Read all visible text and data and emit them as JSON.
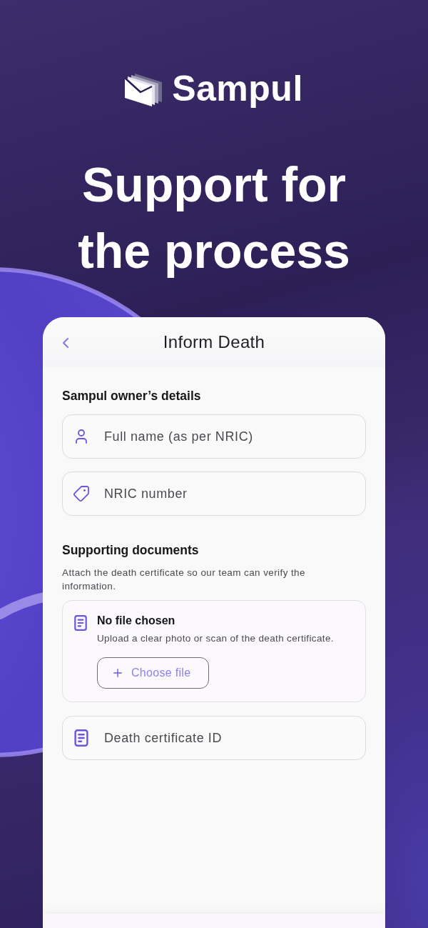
{
  "brand": {
    "name": "Sampul"
  },
  "headline": [
    "Support for",
    "the process"
  ],
  "screen": {
    "title": "Inform Death"
  },
  "owner_section": {
    "title": "Sampul owner’s details",
    "fields": [
      {
        "kind": "person",
        "placeholder": "Full name (as per NRIC)"
      },
      {
        "kind": "tag",
        "placeholder": "NRIC number"
      }
    ]
  },
  "documents_section": {
    "title": "Supporting documents",
    "description": "Attach the death certificate so our team can verify the information.",
    "upload": {
      "title": "No file chosen",
      "hint": "Upload a clear photo or scan of the death certificate.",
      "button": "Choose file"
    },
    "fields": [
      {
        "kind": "document",
        "placeholder": "Death certificate ID"
      }
    ]
  }
}
